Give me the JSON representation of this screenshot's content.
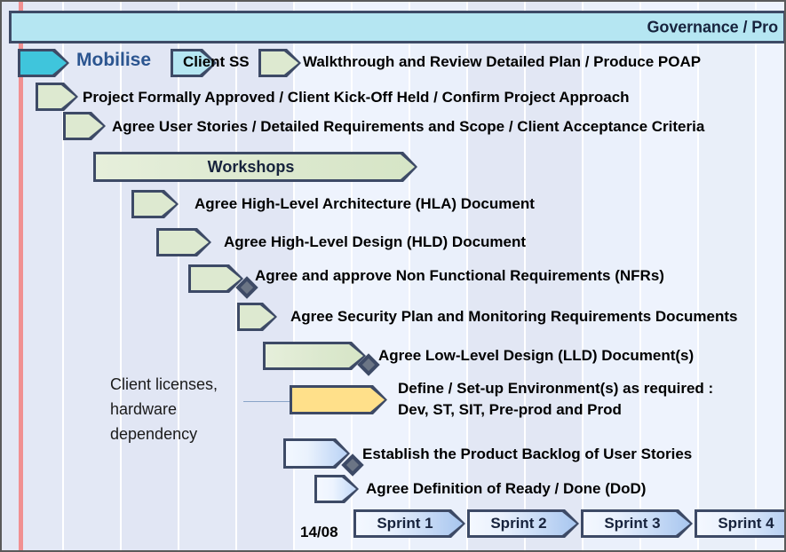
{
  "banner": {
    "label": "Governance / Pro"
  },
  "today_marker": {
    "color": "#f18b8b"
  },
  "phase": {
    "mobilise_label": "Mobilise"
  },
  "colors": {
    "accent_blue": "#2b5590",
    "outline": "#3d4a66",
    "green_fill": "#dde9d0",
    "cyan_fill": "#3fc5dc",
    "light_cyan_fill": "#b5e6f2",
    "yellow_fill": "#ffe08a",
    "today_red": "#f18b8b",
    "banner_fill": "#b5e6f2",
    "background": "#e3e8f5"
  },
  "tasks": [
    {
      "id": "mobilise",
      "label": "Mobilise",
      "bar_label": "",
      "fill": "cyan"
    },
    {
      "id": "client-ss",
      "label": "Client SS",
      "bar_label": "",
      "fill": "lcyan"
    },
    {
      "id": "walkthrough",
      "label": "Walkthrough and Review Detailed Plan / Produce POAP",
      "bar_label": "",
      "fill": "green"
    },
    {
      "id": "approval",
      "label": "Project Formally Approved / Client Kick-Off Held / Confirm Project Approach",
      "bar_label": "",
      "fill": "green"
    },
    {
      "id": "user-stories",
      "label": "Agree User Stories / Detailed Requirements and Scope / Client Acceptance Criteria",
      "bar_label": "",
      "fill": "green"
    },
    {
      "id": "workshops",
      "label": "",
      "bar_label": "Workshops",
      "fill": "green"
    },
    {
      "id": "hla",
      "label": "Agree High-Level Architecture (HLA) Document",
      "bar_label": "",
      "fill": "green"
    },
    {
      "id": "hld",
      "label": "Agree High-Level Design (HLD) Document",
      "bar_label": "",
      "fill": "green"
    },
    {
      "id": "nfr",
      "label": "Agree and approve Non Functional Requirements (NFRs)",
      "bar_label": "",
      "fill": "green"
    },
    {
      "id": "security",
      "label": "Agree Security Plan and Monitoring Requirements Documents",
      "bar_label": "",
      "fill": "green"
    },
    {
      "id": "lld",
      "label": "Agree Low-Level Design (LLD) Document(s)",
      "bar_label": "",
      "fill": "green"
    },
    {
      "id": "environments",
      "label": "Define / Set-up Environment(s) as required :\nDev, ST, SIT, Pre-prod and Prod",
      "bar_label": "",
      "fill": "yellow"
    },
    {
      "id": "backlog",
      "label": "Establish the Product Backlog of User Stories",
      "bar_label": "",
      "fill": "blue"
    },
    {
      "id": "dod",
      "label": "Agree Definition of Ready / Done (DoD)",
      "bar_label": "",
      "fill": "blue"
    }
  ],
  "task_labels": {
    "walkthrough": "Walkthrough and Review Detailed Plan / Produce POAP",
    "approval": "Project Formally Approved / Client Kick-Off Held / Confirm Project Approach",
    "user_stories": "Agree User Stories / Detailed Requirements and Scope / Client Acceptance Criteria",
    "workshops": "Workshops",
    "hla": "Agree High-Level Architecture (HLA) Document",
    "hld": "Agree High-Level Design (HLD) Document",
    "nfr": "Agree and approve Non Functional Requirements (NFRs)",
    "security": "Agree Security Plan and Monitoring Requirements Documents",
    "lld": "Agree Low-Level Design (LLD) Document(s)",
    "environments_line1": "Define / Set-up Environment(s) as required :",
    "environments_line2": "Dev, ST, SIT, Pre-prod and Prod",
    "backlog": "Establish the Product Backlog of User Stories",
    "dod": "Agree Definition of Ready / Done (DoD)",
    "client_ss": "Client SS"
  },
  "annotation": {
    "line1": "Client licenses,",
    "line2": "hardware",
    "line3": "dependency"
  },
  "timeline": {
    "date_marker": "14/08",
    "sprints": [
      {
        "label": "Sprint 1"
      },
      {
        "label": "Sprint 2"
      },
      {
        "label": "Sprint 3"
      },
      {
        "label": "Sprint 4"
      }
    ]
  }
}
